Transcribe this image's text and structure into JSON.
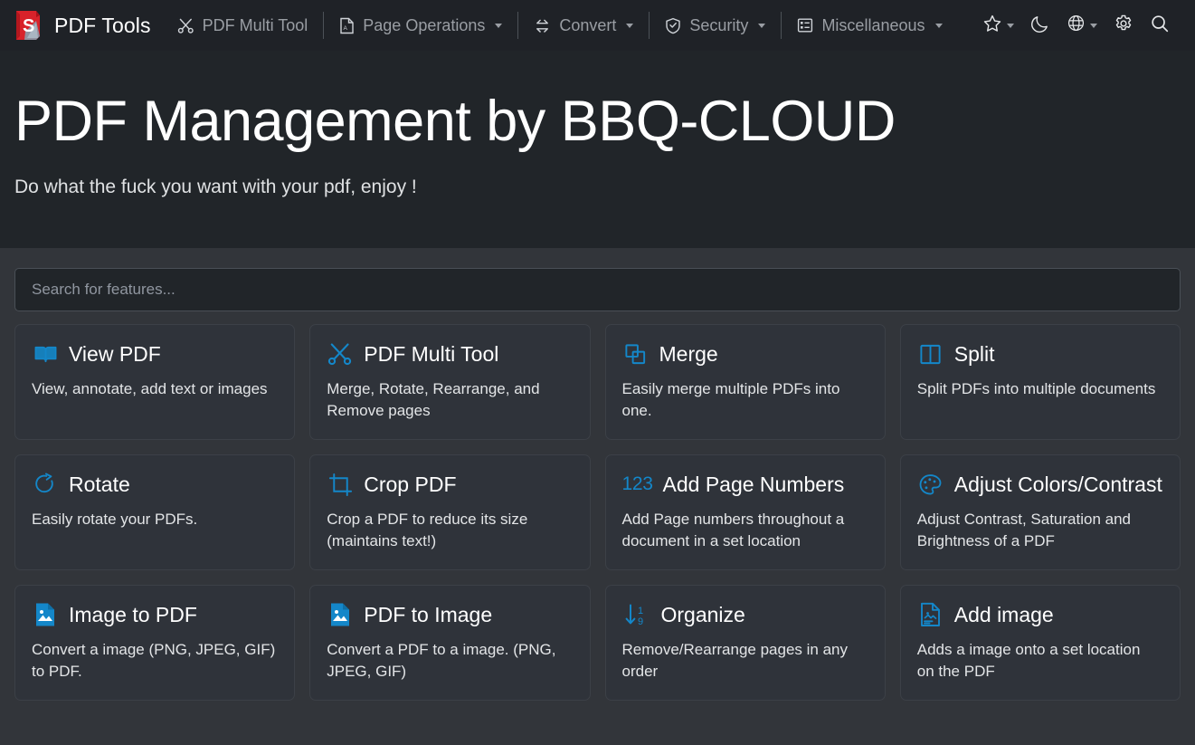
{
  "navbar": {
    "brand": {
      "title": "PDF Tools",
      "logo_icon": "pdf-logo-icon"
    },
    "items": [
      {
        "label": "PDF Multi Tool",
        "icon": "scissors-tool-icon",
        "has_caret": false,
        "separator_after": true
      },
      {
        "label": "Page Operations",
        "icon": "page-file-icon",
        "has_caret": true,
        "separator_after": true
      },
      {
        "label": "Convert",
        "icon": "convert-arrows-icon",
        "has_caret": true,
        "separator_after": true
      },
      {
        "label": "Security",
        "icon": "shield-check-icon",
        "has_caret": true,
        "separator_after": true
      },
      {
        "label": "Miscellaneous",
        "icon": "list-box-icon",
        "has_caret": true,
        "separator_after": false
      }
    ],
    "right_icons": [
      {
        "name": "star-favorites-icon",
        "has_caret": true
      },
      {
        "name": "moon-dark-mode-icon",
        "has_caret": false
      },
      {
        "name": "globe-language-icon",
        "has_caret": true
      },
      {
        "name": "gear-settings-icon",
        "has_caret": false
      },
      {
        "name": "search-icon",
        "has_caret": false
      }
    ]
  },
  "hero": {
    "title": "PDF Management by BBQ-CLOUD",
    "subtitle": "Do what the fuck you want with your pdf, enjoy !"
  },
  "search": {
    "placeholder": "Search for features...",
    "value": ""
  },
  "colors": {
    "accent": "#1487c9",
    "navbar_bg": "#1f2227",
    "hero_bg": "#212529",
    "page_bg": "#32353a",
    "card_bg": "#2f333a",
    "card_border": "#3c4047",
    "logo_red": "#d8222a"
  },
  "cards": [
    {
      "title": "View PDF",
      "desc": "View, annotate, add text or images",
      "icon": "open-book-icon"
    },
    {
      "title": "PDF Multi Tool",
      "desc": "Merge, Rotate, Rearrange, and Remove pages",
      "icon": "scissors-tool-icon"
    },
    {
      "title": "Merge",
      "desc": "Easily merge multiple PDFs into one.",
      "icon": "overlapping-squares-icon"
    },
    {
      "title": "Split",
      "desc": "Split PDFs into multiple documents",
      "icon": "split-columns-icon"
    },
    {
      "title": "Rotate",
      "desc": "Easily rotate your PDFs.",
      "icon": "rotate-arrow-icon"
    },
    {
      "title": "Crop PDF",
      "desc": "Crop a PDF to reduce its size (maintains text!)",
      "icon": "crop-icon"
    },
    {
      "title": "Add Page Numbers",
      "desc": "Add Page numbers throughout a document in a set location",
      "icon": "123-text-icon",
      "icon_text": "123"
    },
    {
      "title": "Adjust Colors/Contrast",
      "desc": "Adjust Contrast, Saturation and Brightness of a PDF",
      "icon": "palette-icon"
    },
    {
      "title": "Image to PDF",
      "desc": "Convert a image (PNG, JPEG, GIF) to PDF.",
      "icon": "file-image-icon"
    },
    {
      "title": "PDF to Image",
      "desc": "Convert a PDF to a image. (PNG, JPEG, GIF)",
      "icon": "file-image-icon"
    },
    {
      "title": "Organize",
      "desc": "Remove/Rearrange pages in any order",
      "icon": "sort-numeric-down-icon"
    },
    {
      "title": "Add image",
      "desc": "Adds a image onto a set location on the PDF",
      "icon": "file-add-image-icon"
    }
  ]
}
